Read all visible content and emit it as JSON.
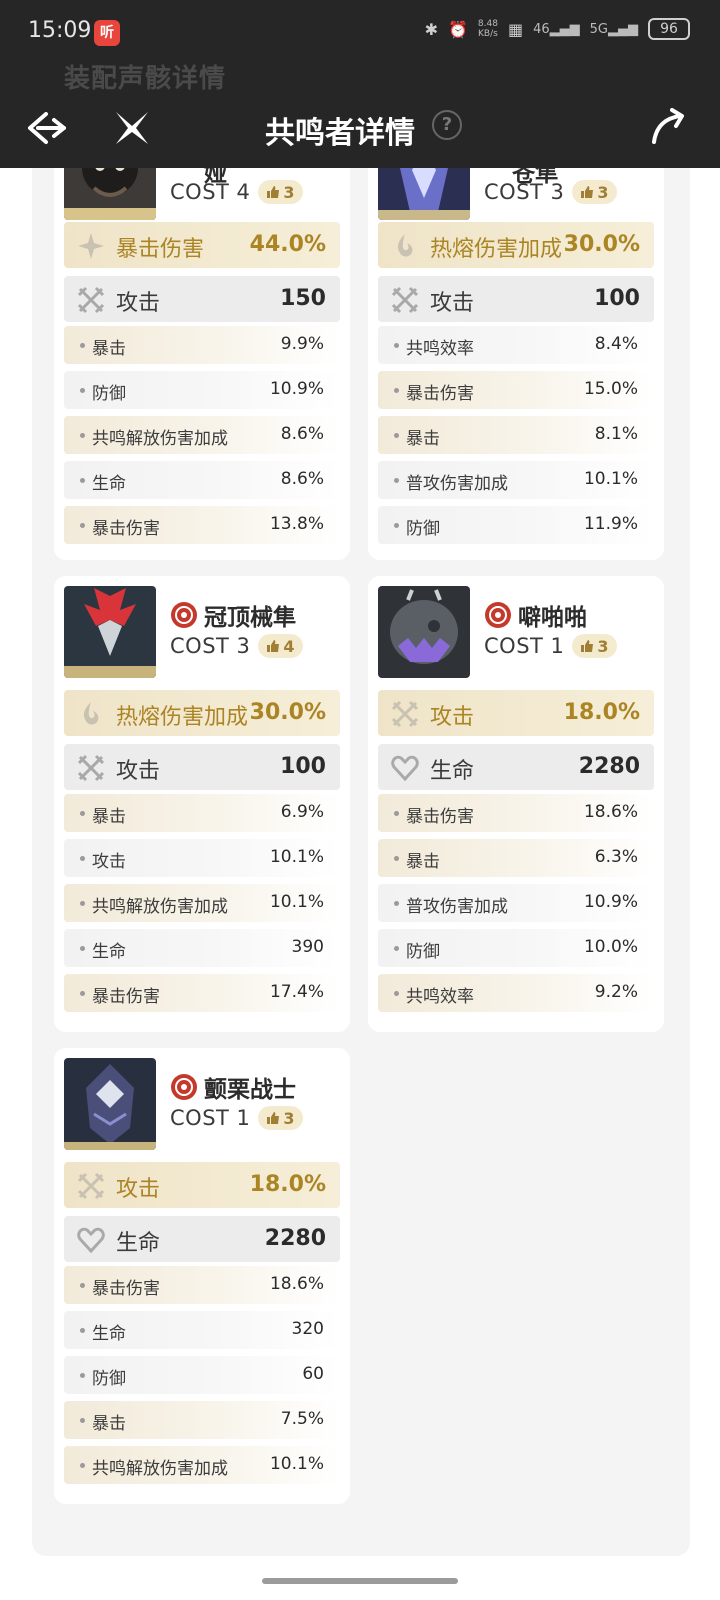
{
  "status_bar": {
    "time": "15:09",
    "app_badge": "听",
    "net_speed_top": "8.48",
    "net_speed_unit": "KB/s",
    "sig1": "46",
    "sig2": "5G",
    "battery": "96"
  },
  "header": {
    "faded_heading": "装配声骸详情",
    "title": "共鸣者详情",
    "help": "?"
  },
  "cards": [
    {
      "name": "共鸣回响·妮娅",
      "cost": "COST 4",
      "level": "3",
      "main": {
        "label": "暴击伤害",
        "value": "44.0%",
        "icon": "crit-damage-icon"
      },
      "flat": {
        "label": "攻击",
        "value": "150",
        "icon": "attack-icon"
      },
      "subs": [
        {
          "label": "暴击",
          "value": "9.9%",
          "tone": "gold"
        },
        {
          "label": "防御",
          "value": "10.9%",
          "tone": "grey"
        },
        {
          "label": "共鸣解放伤害加成",
          "value": "8.6%",
          "tone": "gold"
        },
        {
          "label": "生命",
          "value": "8.6%",
          "tone": "grey"
        },
        {
          "label": "暴击伤害",
          "value": "13.8%",
          "tone": "gold"
        }
      ]
    },
    {
      "name": "共鸣回响·冠顶苍隼",
      "cost": "COST 3",
      "level": "3",
      "main": {
        "label": "热熔伤害加成",
        "value": "30.0%",
        "icon": "fusion-damage-icon"
      },
      "flat": {
        "label": "攻击",
        "value": "100",
        "icon": "attack-icon"
      },
      "subs": [
        {
          "label": "共鸣效率",
          "value": "8.4%",
          "tone": "grey"
        },
        {
          "label": "暴击伤害",
          "value": "15.0%",
          "tone": "gold"
        },
        {
          "label": "暴击",
          "value": "8.1%",
          "tone": "gold"
        },
        {
          "label": "普攻伤害加成",
          "value": "10.1%",
          "tone": "grey"
        },
        {
          "label": "防御",
          "value": "11.9%",
          "tone": "grey"
        }
      ]
    },
    {
      "name": "冠顶械隼",
      "cost": "COST 3",
      "level": "4",
      "main": {
        "label": "热熔伤害加成",
        "value": "30.0%",
        "icon": "fusion-damage-icon"
      },
      "flat": {
        "label": "攻击",
        "value": "100",
        "icon": "attack-icon"
      },
      "subs": [
        {
          "label": "暴击",
          "value": "6.9%",
          "tone": "gold"
        },
        {
          "label": "攻击",
          "value": "10.1%",
          "tone": "grey"
        },
        {
          "label": "共鸣解放伤害加成",
          "value": "10.1%",
          "tone": "gold"
        },
        {
          "label": "生命",
          "value": "390",
          "tone": "grey"
        },
        {
          "label": "暴击伤害",
          "value": "17.4%",
          "tone": "gold"
        }
      ]
    },
    {
      "name": "噼啪啪",
      "cost": "COST 1",
      "level": "3",
      "main": {
        "label": "攻击",
        "value": "18.0%",
        "icon": "attack-icon"
      },
      "flat": {
        "label": "生命",
        "value": "2280",
        "icon": "health-icon"
      },
      "subs": [
        {
          "label": "暴击伤害",
          "value": "18.6%",
          "tone": "gold"
        },
        {
          "label": "暴击",
          "value": "6.3%",
          "tone": "gold"
        },
        {
          "label": "普攻伤害加成",
          "value": "10.9%",
          "tone": "grey"
        },
        {
          "label": "防御",
          "value": "10.0%",
          "tone": "grey"
        },
        {
          "label": "共鸣效率",
          "value": "9.2%",
          "tone": "gold"
        }
      ]
    },
    {
      "name": "颤栗战士",
      "cost": "COST 1",
      "level": "3",
      "main": {
        "label": "攻击",
        "value": "18.0%",
        "icon": "attack-icon"
      },
      "flat": {
        "label": "生命",
        "value": "2280",
        "icon": "health-icon"
      },
      "subs": [
        {
          "label": "暴击伤害",
          "value": "18.6%",
          "tone": "gold"
        },
        {
          "label": "生命",
          "value": "320",
          "tone": "grey"
        },
        {
          "label": "防御",
          "value": "60",
          "tone": "grey"
        },
        {
          "label": "暴击",
          "value": "7.5%",
          "tone": "gold"
        },
        {
          "label": "共鸣解放伤害加成",
          "value": "10.1%",
          "tone": "gold"
        }
      ]
    }
  ]
}
